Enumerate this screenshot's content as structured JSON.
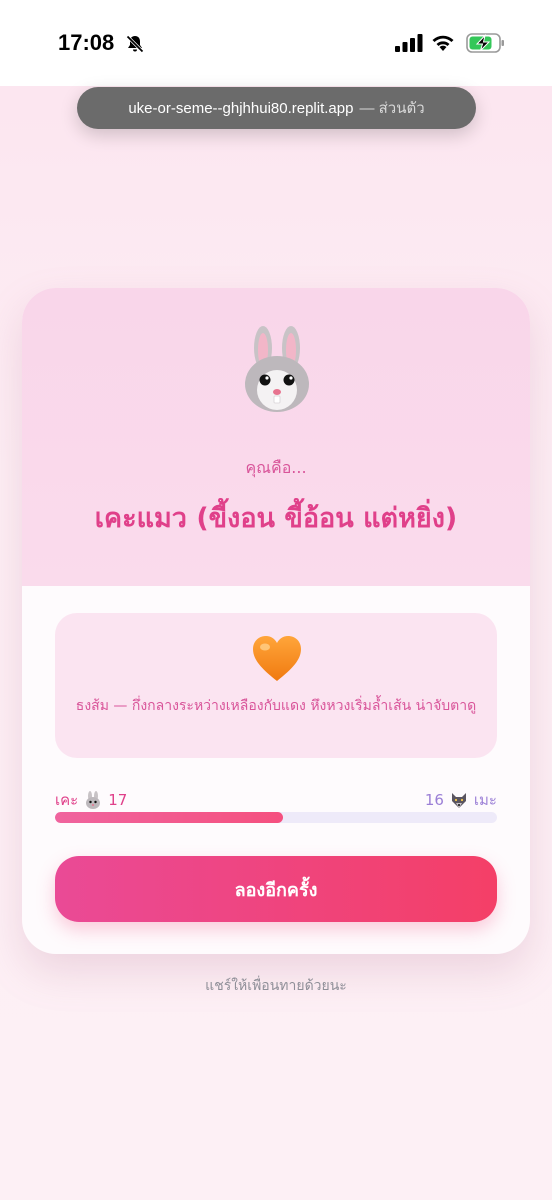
{
  "status_bar": {
    "time": "17:08",
    "icons": [
      "bell-slash-icon",
      "cellular-signal-icon",
      "wifi-icon",
      "battery-charging-icon"
    ]
  },
  "browser": {
    "url": "uke-or-seme--ghjhhui80.replit.app",
    "mode_label": "— ส่วนตัว"
  },
  "result": {
    "icon": "rabbit-face-icon",
    "intro": "คุณคือ...",
    "type_name": "เคะแมว (ขี้งอน ขี้อ้อน แต่หยิ่ง)"
  },
  "color_card": {
    "icon": "orange-heart-icon",
    "description": "ธงส้ม — กึ่งกลางระหว่างเหลืองกับแดง หึงหวงเริ่มล้ำเส้น น่าจับตาดู"
  },
  "score": {
    "uke_label": "เคะ",
    "uke_icon": "rabbit-face-icon",
    "uke_value": "17",
    "seme_label": "เมะ",
    "seme_icon": "wolf-face-icon",
    "seme_value": "16",
    "uke_fraction": 0.515
  },
  "actions": {
    "retry_label": "ลองอีกครั้ง"
  },
  "footer": {
    "share_text": "แชร์ให้เพื่อนทายด้วยนะ"
  },
  "colors": {
    "accent_pink": "#e0408a",
    "accent_purple": "#9b7fd6",
    "button_gradient_start": "#ea4a96",
    "button_gradient_end": "#f43f67"
  }
}
